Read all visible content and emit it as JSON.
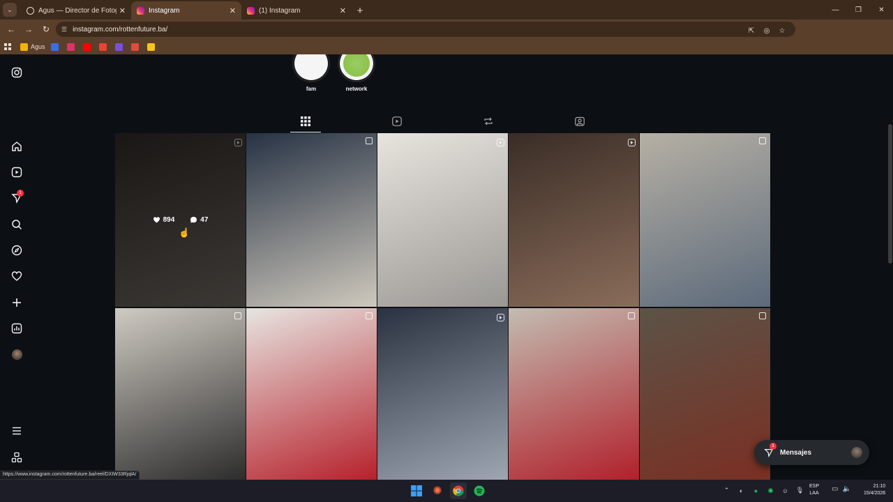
{
  "browser": {
    "tabs": [
      {
        "title": "Agus — Director de Fotografía",
        "active": false,
        "favicon_color": "#3c2a1c"
      },
      {
        "title": "Instagram",
        "active": true,
        "favicon_color": "#e1306c"
      },
      {
        "title": "(1) Instagram",
        "active": false,
        "favicon_color": "#e1306c"
      }
    ],
    "new_tab_icon": "plus-icon",
    "url": "instagram.com/rottenfuture.ba/",
    "bookmarks": [
      {
        "label": "Agus",
        "icon": "drive-icon",
        "color": "#f4b400"
      },
      {
        "label": "",
        "icon": "a-icon",
        "color": "#3a6ee8"
      },
      {
        "label": "",
        "icon": "instagram-icon",
        "color": "#e1306c"
      },
      {
        "label": "",
        "icon": "youtube-icon",
        "color": "#ff0000"
      },
      {
        "label": "",
        "icon": "gmail-icon",
        "color": "#ea4335"
      },
      {
        "label": "",
        "icon": "app-icon",
        "color": "#7a4fe0"
      },
      {
        "label": "",
        "icon": "spark-icon",
        "color": "#e24a3c"
      },
      {
        "label": "",
        "icon": "imdb-icon",
        "color": "#f5c518"
      }
    ]
  },
  "highlights": [
    {
      "label": "fam",
      "color": "#f5f5f5"
    },
    {
      "label": "network",
      "color": "#8bc34a"
    }
  ],
  "profile_tabs": [
    "grid-icon",
    "reels-icon",
    "reposts-icon",
    "tagged-icon"
  ],
  "sidebar": [
    "instagram-icon",
    "home-icon",
    "reels-icon",
    "messages-icon",
    "search-icon",
    "explore-icon",
    "notifications-icon",
    "create-icon",
    "dashboard-icon",
    "profile-avatar",
    "menu-icon",
    "threads-icon"
  ],
  "sidebar_badge": "1",
  "posts": [
    {
      "type": "reel",
      "hover": true,
      "likes": "894",
      "comments": "47",
      "colors": [
        "#2f2b27",
        "#6d6760"
      ]
    },
    {
      "type": "carousel",
      "colors": [
        "#263244",
        "#cfc9bd"
      ]
    },
    {
      "type": "reel",
      "colors": [
        "#e7e4de",
        "#9a9894"
      ]
    },
    {
      "type": "reel",
      "colors": [
        "#3a2d26",
        "#8a6c5a"
      ]
    },
    {
      "type": "carousel",
      "colors": [
        "#b6b0a4",
        "#5c6a7b"
      ]
    },
    {
      "type": "carousel",
      "colors": [
        "#cfcac2",
        "#2b2b2b"
      ]
    },
    {
      "type": "carousel",
      "colors": [
        "#e7e5e1",
        "#b61f2a"
      ]
    },
    {
      "type": "reel",
      "colors": [
        "#2a3140",
        "#9fa7b3"
      ]
    },
    {
      "type": "carousel",
      "colors": [
        "#c3bcb1",
        "#b11f2a"
      ]
    },
    {
      "type": "carousel",
      "colors": [
        "#5c5347",
        "#7a2f22"
      ]
    }
  ],
  "messages": {
    "label": "Mensajes",
    "badge": "1"
  },
  "status_url": "https://www.instagram.com/rottenfuture.ba/reel/DXIW33RjqlA/",
  "taskbar": {
    "lang_top": "ESP",
    "lang_bottom": "LAA",
    "time": "21:10",
    "date": "15/4/2026"
  }
}
